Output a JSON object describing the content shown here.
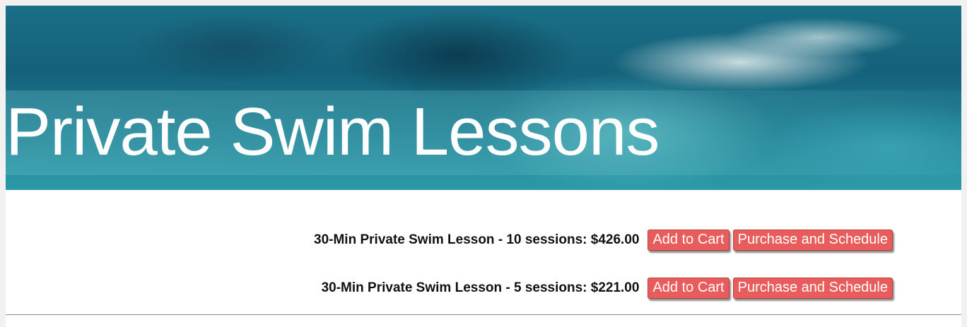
{
  "hero": {
    "title": "Private Swim Lessons"
  },
  "products": [
    {
      "label": "30-Min Private Swim Lesson - 10 sessions: $426.00",
      "add_to_cart_label": "Add to Cart",
      "purchase_label": "Purchase and Schedule"
    },
    {
      "label": "30-Min Private Swim Lesson - 5 sessions: $221.00",
      "add_to_cart_label": "Add to Cart",
      "purchase_label": "Purchase and Schedule"
    }
  ],
  "colors": {
    "button_bg": "#e95c5c",
    "button_text": "#ffffff",
    "hero_title": "#ffffff"
  }
}
